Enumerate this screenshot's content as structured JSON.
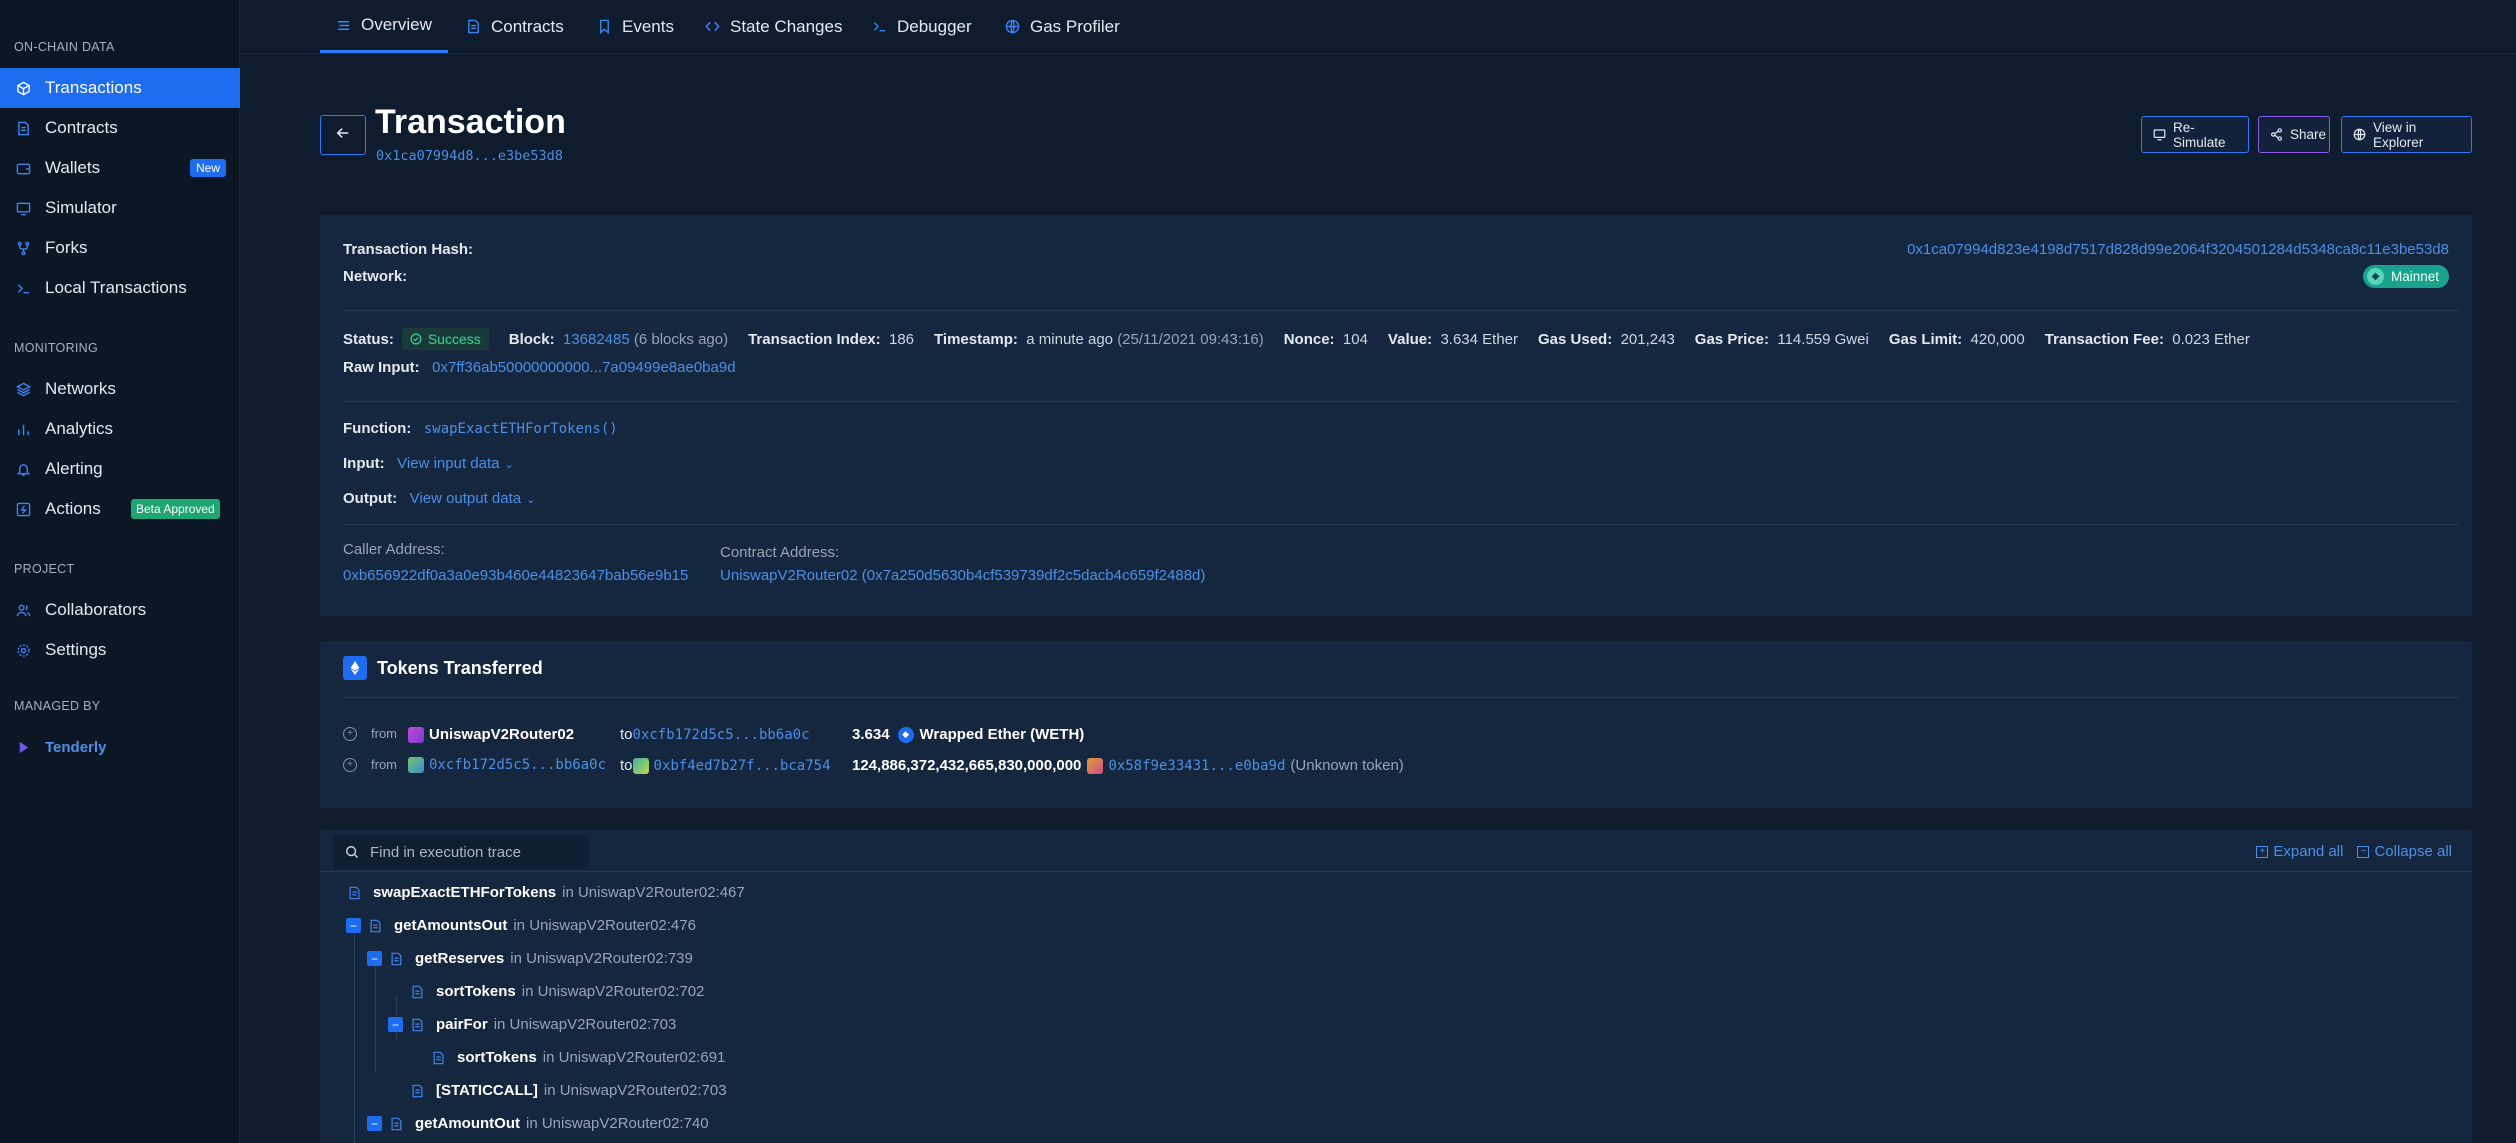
{
  "sidebar": {
    "sections": {
      "on_chain": "ON-CHAIN DATA",
      "monitoring": "MONITORING",
      "project": "PROJECT",
      "managed_by": "MANAGED BY"
    },
    "items": {
      "transactions": "Transactions",
      "contracts": "Contracts",
      "wallets": "Wallets",
      "wallets_badge": "New",
      "simulator": "Simulator",
      "forks": "Forks",
      "local_transactions": "Local Transactions",
      "networks": "Networks",
      "analytics": "Analytics",
      "alerting": "Alerting",
      "actions": "Actions",
      "actions_badge": "Beta Approved",
      "collaborators": "Collaborators",
      "settings": "Settings",
      "tenderly": "Tenderly"
    }
  },
  "tabs": {
    "overview": "Overview",
    "contracts": "Contracts",
    "events": "Events",
    "state_changes": "State Changes",
    "debugger": "Debugger",
    "gas_profiler": "Gas Profiler"
  },
  "header": {
    "title": "Transaction",
    "hash_short": "0x1ca07994d8...e3be53d8",
    "resimulate": "Re-Simulate",
    "share": "Share",
    "view_explorer": "View in Explorer"
  },
  "tx": {
    "hash_label": "Transaction Hash:",
    "hash": "0x1ca07994d823e4198d7517d828d99e2064f3204501284d5348ca8c11e3be53d8",
    "network_label": "Network:",
    "network": "Mainnet",
    "status_label": "Status:",
    "status": "Success",
    "block_label": "Block:",
    "block": "13682485",
    "block_note": "(6 blocks ago)",
    "index_label": "Transaction Index:",
    "index": "186",
    "timestamp_label": "Timestamp:",
    "timestamp": "a minute ago",
    "timestamp_full": "(25/11/2021 09:43:16)",
    "nonce_label": "Nonce:",
    "nonce": "104",
    "value_label": "Value:",
    "value": "3.634 Ether",
    "gas_used_label": "Gas Used:",
    "gas_used": "201,243",
    "gas_price_label": "Gas Price:",
    "gas_price": "114.559 Gwei",
    "gas_limit_label": "Gas Limit:",
    "gas_limit": "420,000",
    "fee_label": "Transaction Fee:",
    "fee": "0.023 Ether",
    "raw_input_label": "Raw Input:",
    "raw_input": "0x7ff36ab50000000000...7a09499e8ae0ba9d",
    "function_label": "Function:",
    "function": "swapExactETHForTokens()",
    "input_label": "Input:",
    "input_link": "View input data",
    "output_label": "Output:",
    "output_link": "View output data",
    "caller_label": "Caller Address:",
    "caller": "0xb656922df0a3a0e93b460e44823647bab56e9b15",
    "contract_label": "Contract Address:",
    "contract": "UniswapV2Router02 (0x7a250d5630b4cf539739df2c5dacb4c659f2488d)"
  },
  "tokens": {
    "title": "Tokens Transferred",
    "from_word": "from",
    "to_word": "to",
    "rows": [
      {
        "from": "UniswapV2Router02",
        "to": "0xcfb172d5c5...bb6a0c",
        "amount": "3.634",
        "token": "Wrapped Ether (WETH)"
      },
      {
        "from": "0xcfb172d5c5...bb6a0c",
        "to": "0xbf4ed7b27f...bca754",
        "amount": "124,886,372,432,665,830,000,000",
        "token": "0x58f9e33431...e0ba9d",
        "token_note": "(Unknown token)"
      }
    ]
  },
  "trace": {
    "search_placeholder": "Find in execution trace",
    "expand_all": "Expand all",
    "collapse_all": "Collapse all",
    "in_word": "in",
    "rows": [
      {
        "fn": "swapExactETHForTokens",
        "loc": "UniswapV2Router02:467"
      },
      {
        "fn": "getAmountsOut",
        "loc": "UniswapV2Router02:476"
      },
      {
        "fn": "getReserves",
        "loc": "UniswapV2Router02:739"
      },
      {
        "fn": "sortTokens",
        "loc": "UniswapV2Router02:702"
      },
      {
        "fn": "pairFor",
        "loc": "UniswapV2Router02:703"
      },
      {
        "fn": "sortTokens",
        "loc": "UniswapV2Router02:691"
      },
      {
        "fn": "[STATICCALL]",
        "loc": "UniswapV2Router02:703"
      },
      {
        "fn": "getAmountOut",
        "loc": "UniswapV2Router02:740"
      }
    ]
  },
  "colors": {
    "accent": "#1e6cf0",
    "link": "#4d8fe6",
    "success": "#3fd49a",
    "background": "#0f1c2e",
    "panel": "#15273e"
  }
}
